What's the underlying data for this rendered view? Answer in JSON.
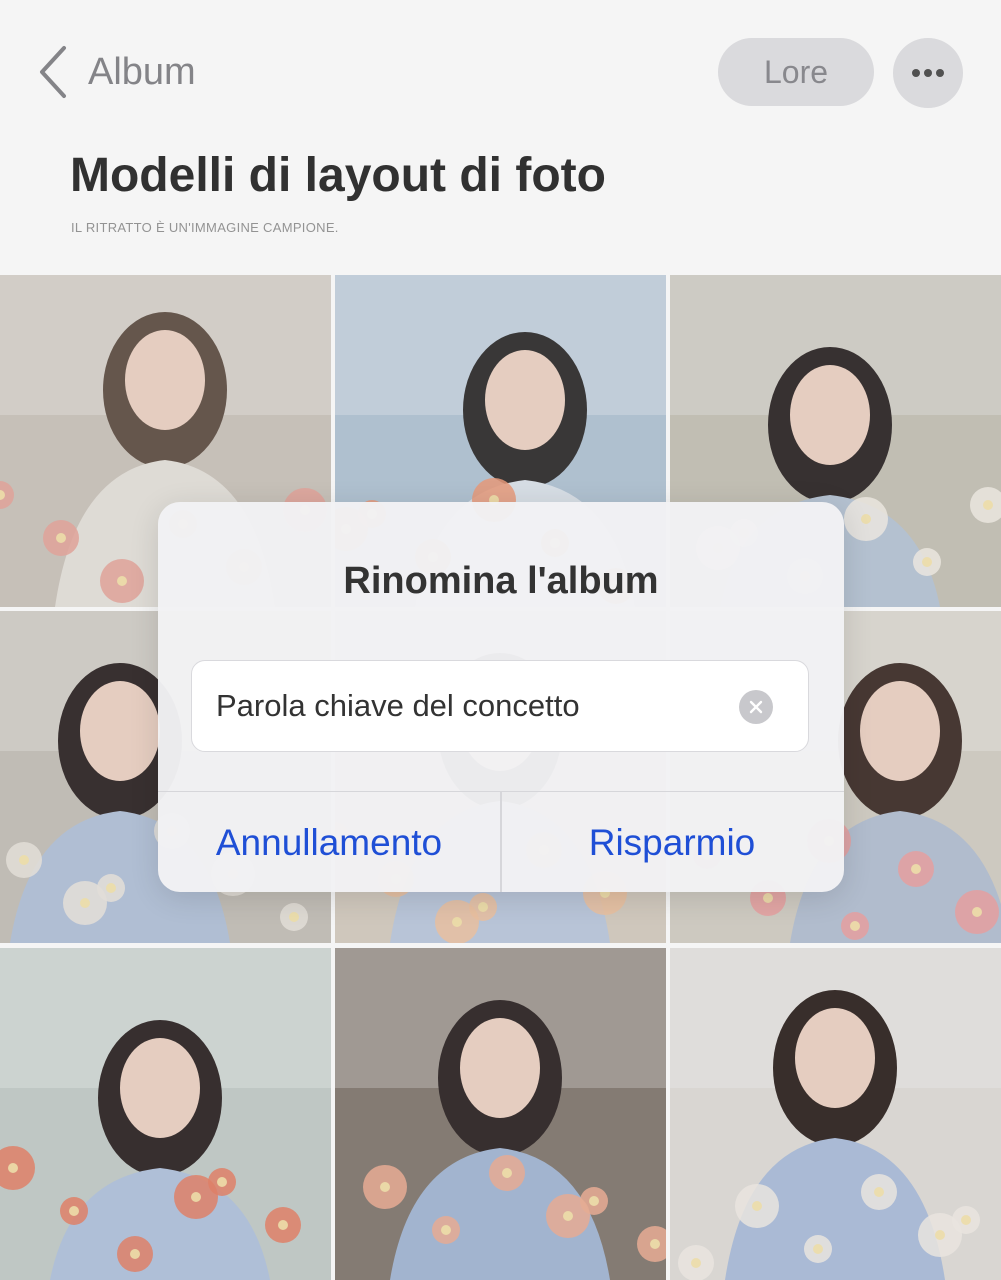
{
  "header": {
    "back_label": "Album",
    "lore_button": "Lore",
    "more_icon": "more-horizontal-icon",
    "title": "Modelli di layout di foto",
    "subtitle": "IL RITRATTO È UN'IMMAGINE CAMPIONE."
  },
  "gallery": {
    "photos": [
      {
        "name": "woman-white-shirt-flowers-closeup",
        "palette": [
          "#cfc8c0",
          "#6a5a50",
          "#e8e4de",
          "#e9a9a0"
        ]
      },
      {
        "name": "woman-window-flowers-profile",
        "palette": [
          "#b7c8d8",
          "#3c3a3a",
          "#dfe6ee",
          "#f0a080"
        ]
      },
      {
        "name": "woman-flower-shop-standing",
        "palette": [
          "#c9c6bb",
          "#3a3333",
          "#bcc9d9",
          "#f4f0e8"
        ]
      },
      {
        "name": "woman-blue-shirt-indoor",
        "palette": [
          "#c8c4bd",
          "#3b3232",
          "#b8c6dc",
          "#ece8e1"
        ]
      },
      {
        "name": "woman-flowers-foreground",
        "palette": [
          "#d8d0c4",
          "#3b3232",
          "#c0cde0",
          "#f2c7a6"
        ]
      },
      {
        "name": "woman-profile-pink-flowers",
        "palette": [
          "#d6d2c8",
          "#4a3b36",
          "#b9c4d6",
          "#eea6a6"
        ]
      },
      {
        "name": "woman-seated-flower-shop",
        "palette": [
          "#c7d0cd",
          "#3a3131",
          "#b7c7e0",
          "#e8866c"
        ]
      },
      {
        "name": "woman-behind-glass-flowers",
        "palette": [
          "#8a8078",
          "#3a3131",
          "#a9bcd8",
          "#f0b39a"
        ]
      },
      {
        "name": "woman-hand-in-hair",
        "palette": [
          "#e2dfdb",
          "#3b302d",
          "#b1c2de",
          "#f3efe9"
        ]
      }
    ]
  },
  "dialog": {
    "title": "Rinomina l'album",
    "input_value": "Parola chiave del concetto",
    "clear_icon": "clear-circle-icon",
    "cancel_label": "Annullamento",
    "save_label": "Risparmio",
    "accent_color": "#1f4fd6"
  }
}
